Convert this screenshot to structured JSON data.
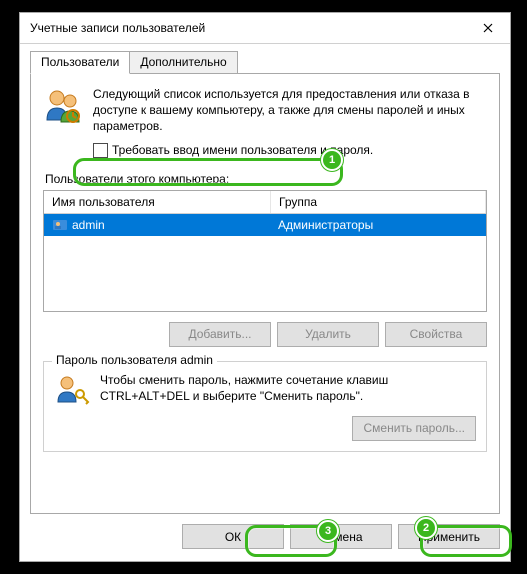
{
  "window": {
    "title": "Учетные записи пользователей"
  },
  "tabs": {
    "active": "Пользователи",
    "inactive": "Дополнительно"
  },
  "intro": "Следующий список используется для предоставления или отказа в доступе к вашему компьютеру, а также для смены паролей и иных параметров.",
  "require_login_label": "Требовать ввод имени пользователя и пароля.",
  "require_login_checked": false,
  "section_label": "Пользователи этого компьютера:",
  "columns": {
    "user": "Имя пользователя",
    "group": "Группа"
  },
  "rows": [
    {
      "user": "admin",
      "group": "Администраторы"
    }
  ],
  "buttons": {
    "add": "Добавить...",
    "remove": "Удалить",
    "props": "Свойства"
  },
  "pw_group": {
    "title": "Пароль пользователя admin",
    "text": "Чтобы сменить пароль, нажмите сочетание клавиш CTRL+ALT+DEL и выберите \"Сменить пароль\".",
    "button": "Сменить пароль..."
  },
  "footer": {
    "ok": "ОК",
    "cancel": "Отмена",
    "apply": "Применить"
  },
  "annotations": {
    "a1": "1",
    "a2": "2",
    "a3": "3"
  }
}
